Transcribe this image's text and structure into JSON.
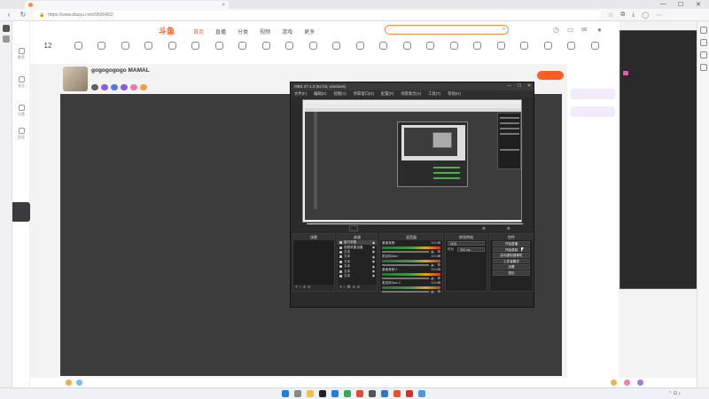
{
  "browser": {
    "tab_title": "",
    "url": "https://www.douyu.com/9606481/",
    "minimize": "—",
    "maximize": "☐",
    "close": "✕"
  },
  "site": {
    "logo": "斗鱼",
    "nav": [
      "首页",
      "直播",
      "分类",
      "视频",
      "游戏",
      "更多"
    ],
    "search_placeholder": "",
    "left_nav": [
      "推荐",
      "关注",
      "分类",
      "发现"
    ],
    "categories": [
      "",
      "",
      "",
      "",
      "",
      "",
      "",
      "",
      "",
      "",
      "",
      "",
      "",
      "",
      "",
      "",
      "",
      "",
      "",
      "",
      "",
      "",
      ""
    ],
    "cat_number": "12"
  },
  "streamer": {
    "name": "gogogogogo MAMAL",
    "sub": "",
    "badges": [
      {
        "text": "",
        "color": "#5f5f5f"
      },
      {
        "text": "",
        "color": "#8c5ce5"
      },
      {
        "text": "",
        "color": "#4f7be3"
      },
      {
        "text": "",
        "color": "#8c5ce5"
      },
      {
        "text": "",
        "color": "#e27ea9"
      },
      {
        "text": "",
        "color": "#f1a43a"
      }
    ],
    "follow_label": ""
  },
  "overlay": {
    "title": "",
    "messages": [
      {
        "text": "",
        "gift": false
      },
      {
        "text": "",
        "gift": true
      },
      {
        "text": "",
        "gift": false
      },
      {
        "text": "",
        "gift": false
      },
      {
        "text": "",
        "gift": false
      },
      {
        "text": "",
        "gift": false
      },
      {
        "text": "",
        "gift": false
      }
    ]
  },
  "obs": {
    "title": "OBS 27.1.3 (64 bit, windows)",
    "menu": [
      "文件(F)",
      "编辑(E)",
      "视图(V)",
      "停靠窗口(D)",
      "配置(P)",
      "场景集合(S)",
      "工具(T)",
      "帮助(H)"
    ],
    "label_row": "",
    "docks": {
      "scenes": "场景",
      "sources": "来源",
      "mixer": "混音器",
      "transitions": "转场特效",
      "controls": "控件"
    },
    "sources": [
      {
        "name": "窗口采集",
        "selected": true
      },
      {
        "name": "视频采集设备",
        "selected": false
      },
      {
        "name": "文本",
        "selected": false
      },
      {
        "name": "文本",
        "selected": false
      },
      {
        "name": "文本",
        "selected": false
      },
      {
        "name": "文本",
        "selected": false
      },
      {
        "name": "文本",
        "selected": false
      },
      {
        "name": "文本",
        "selected": false
      }
    ],
    "mixer": [
      {
        "name": "桌面音频",
        "db": "0.0 dB"
      },
      {
        "name": "麦克风/Aux",
        "db": "0.0 dB"
      },
      {
        "name": "桌面音频 2",
        "db": "0.0 dB"
      },
      {
        "name": "麦克风/Aux 2",
        "db": "0.0 dB"
      }
    ],
    "transition": "淡出",
    "duration_label": "时长",
    "duration": "300 ms",
    "controls": [
      "开始直播",
      "开始录制",
      "启动虚拟摄像机",
      "工作室模式",
      "设置",
      "退出"
    ],
    "status": ""
  },
  "taskbar": {
    "time": "",
    "date": ""
  },
  "colors": {
    "brand": "#ff5d23",
    "obs_bg": "#2b2b2b",
    "player_bg": "#3c3c3c"
  }
}
